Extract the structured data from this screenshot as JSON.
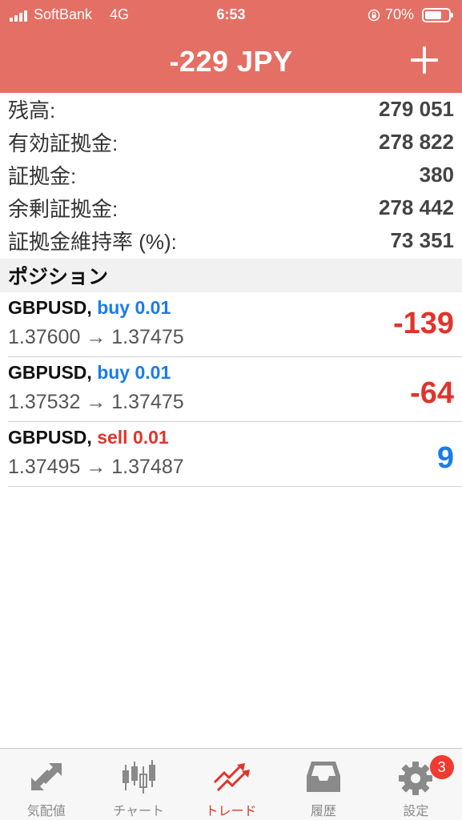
{
  "status_bar": {
    "carrier": "SoftBank",
    "network": "4G",
    "time": "6:53",
    "battery": "70%",
    "battery_level": 0.7
  },
  "header": {
    "title": "-229 JPY",
    "icons": [
      "plus-icon"
    ]
  },
  "summary": [
    {
      "label": "残高:",
      "value": "279 051"
    },
    {
      "label": "有効証拠金:",
      "value": "278 822"
    },
    {
      "label": "証拠金:",
      "value": "380"
    },
    {
      "label": "余剰証拠金:",
      "value": "278 442"
    },
    {
      "label": "証拠金維持率 (%):",
      "value": "73 351"
    }
  ],
  "positions_title": "ポジション",
  "positions": [
    {
      "symbol": "GBPUSD,",
      "side": "buy 0.01",
      "prices": "1.37600 → 1.37475",
      "profit": "-139"
    },
    {
      "symbol": "GBPUSD,",
      "side": "buy 0.01",
      "prices": "1.37532 → 1.37475",
      "profit": "-64"
    },
    {
      "symbol": "GBPUSD,",
      "side": "sell 0.01",
      "prices": "1.37495 → 1.37487",
      "profit": "9"
    }
  ],
  "tabs": [
    {
      "label": "気配値",
      "icon": "quotes-icon"
    },
    {
      "label": "チャート",
      "icon": "candlestick-chart-icon"
    },
    {
      "label": "トレード",
      "icon": "trade-icon",
      "active": true
    },
    {
      "label": "履歴",
      "icon": "inbox-history-icon"
    },
    {
      "label": "設定",
      "icon": "gear-icon",
      "badge": "3"
    }
  ],
  "colors": {
    "header_bg": "#e46f64",
    "buy": "#1a7ce8",
    "sell": "#e0342b",
    "active_tab": "#e0342b"
  }
}
